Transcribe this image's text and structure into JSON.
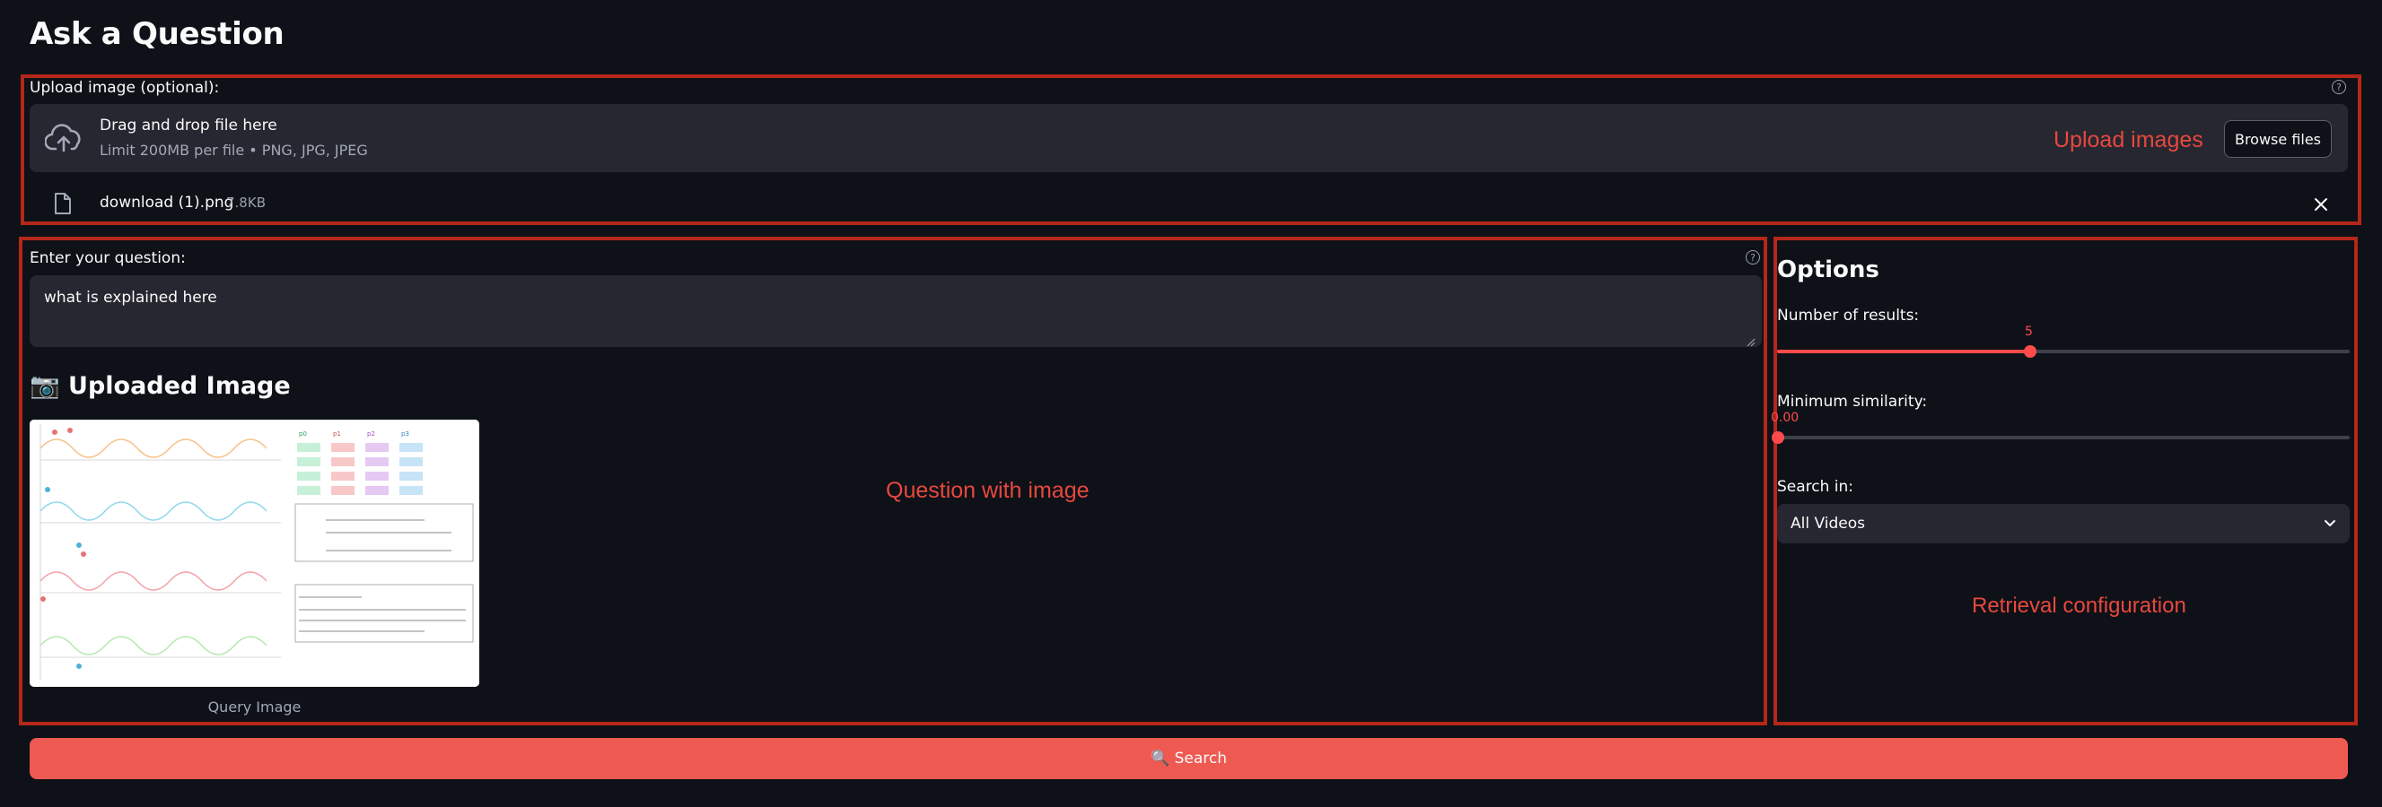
{
  "page": {
    "title": "Ask a Question"
  },
  "upload": {
    "label": "Upload image (optional):",
    "drop_text": "Drag and drop file here",
    "limit_text": "Limit 200MB per file • PNG, JPG, JPEG",
    "browse_label": "Browse files",
    "overlay_label": "Upload images",
    "file": {
      "name": "download (1).png",
      "size": "7.8KB"
    }
  },
  "question": {
    "label": "Enter your question:",
    "value": "what is explained here",
    "overlay_label": "Question with image",
    "uploaded_heading": "📷 Uploaded Image",
    "image_caption": "Query Image"
  },
  "options": {
    "heading": "Options",
    "num_results": {
      "label": "Number of results:",
      "value": "5"
    },
    "min_similarity": {
      "label": "Minimum similarity:",
      "value": "0.00"
    },
    "search_in": {
      "label": "Search in:",
      "selected": "All Videos"
    },
    "overlay_label": "Retrieval configuration"
  },
  "search_button": {
    "label": "🔍 Search"
  },
  "colors": {
    "accent": "#ff4b4b",
    "annotation": "#b5271a",
    "background": "#0e1117",
    "input_bg": "#262730"
  },
  "icons": [
    "upload-cloud-icon",
    "file-icon",
    "close-icon",
    "help-icon",
    "chevron-down-icon",
    "camera-icon",
    "search-icon"
  ]
}
